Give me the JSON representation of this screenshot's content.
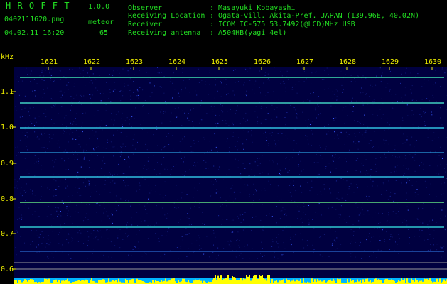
{
  "app": {
    "name": "H R O F F T",
    "version": "1.0.0",
    "filename": "0402111620.png",
    "datetime": "04.02.11 16:20",
    "mode_label": "meteor",
    "meteor_count": "65"
  },
  "info": {
    "labels": [
      "Observer",
      "Receiving Location",
      "Receiver",
      "Receiving antenna"
    ],
    "values": [
      ": Masayuki Kobayashi",
      ": Ogata-vill. Akita-Pref. JAPAN (139.96E, 40.02N)",
      ": ICOM IC-575 53.7492(@LCD)MHz USB",
      ": A504HB(yagi 4el)"
    ]
  },
  "axes": {
    "y_unit": "kHz",
    "x_ticks": [
      "1621",
      "1622",
      "1623",
      "1624",
      "1625",
      "1626",
      "1627",
      "1628",
      "1629",
      "1630"
    ],
    "y_ticks": [
      "1.1",
      "1.0",
      "0.9",
      "0.8",
      "0.7",
      "0.6"
    ]
  },
  "colors": {
    "header_text": "#22dd22",
    "axis_text": "#f0f000",
    "noise_floor": "#000050",
    "baseline_bar": "#00b4ff",
    "bursts": "#ffff00"
  }
}
